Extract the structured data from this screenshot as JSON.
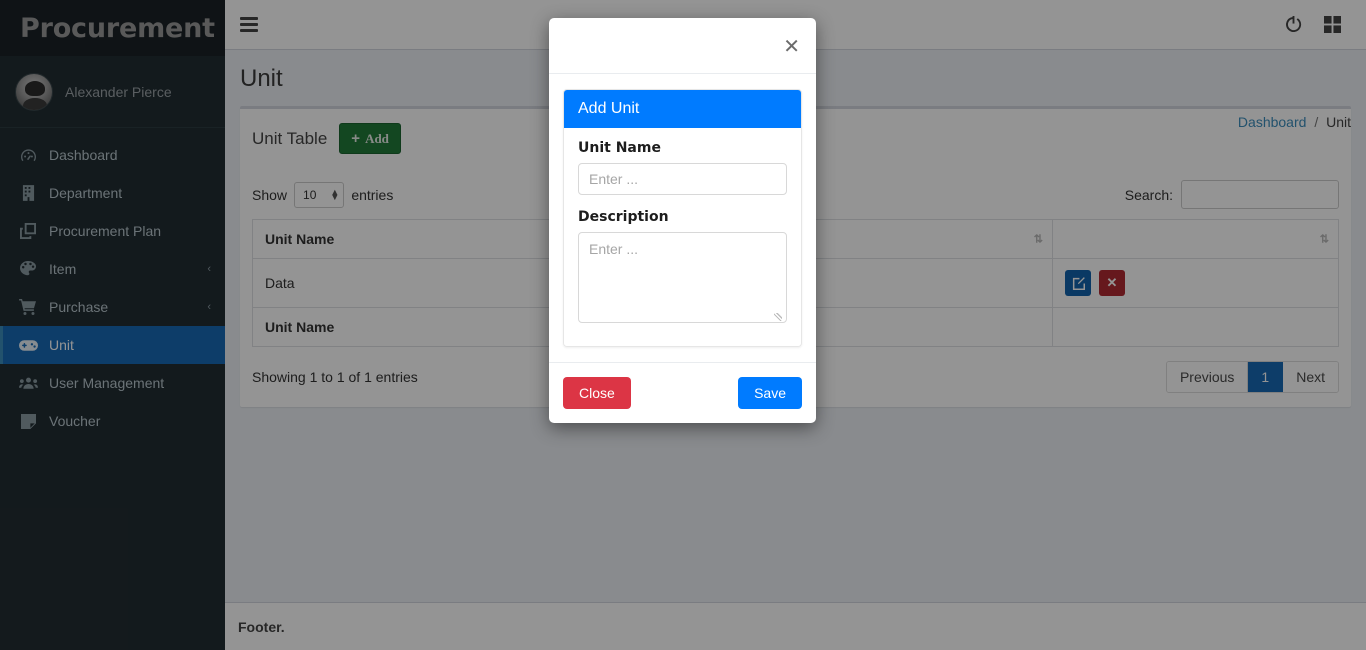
{
  "sidebar": {
    "brand": "Procurement",
    "user": {
      "name": "Alexander Pierce",
      "avatar_icon": "user-avatar"
    },
    "items": [
      {
        "label": "Dashboard",
        "icon": "dashboard-icon",
        "active": false,
        "has_arrow": false
      },
      {
        "label": "Department",
        "icon": "building-icon",
        "active": false,
        "has_arrow": false
      },
      {
        "label": "Procurement Plan",
        "icon": "copy-layers-icon",
        "active": false,
        "has_arrow": false
      },
      {
        "label": "Item",
        "icon": "palette-icon",
        "active": false,
        "has_arrow": true
      },
      {
        "label": "Purchase",
        "icon": "shopping-cart-icon",
        "active": false,
        "has_arrow": true
      },
      {
        "label": "Unit",
        "icon": "gamepad-icon",
        "active": true,
        "has_arrow": false
      },
      {
        "label": "User Management",
        "icon": "users-icon",
        "active": false,
        "has_arrow": false
      },
      {
        "label": "Voucher",
        "icon": "sticky-note-icon",
        "active": false,
        "has_arrow": false
      }
    ],
    "chevron": "‹"
  },
  "navbar": {
    "menu_toggle_icon": "hamburger-icon",
    "power_icon": "power-icon",
    "grid_icon": "grid-squares-icon"
  },
  "header": {
    "title": "Unit",
    "breadcrumb": {
      "home": "Dashboard",
      "separator": "/",
      "current": "Unit"
    }
  },
  "box": {
    "title": "Unit Table",
    "add_button": {
      "label": "Add",
      "plus": "+",
      "color": "#217a3a"
    }
  },
  "datatable": {
    "show_label": "Show",
    "entries_label": "entries",
    "page_length": "10",
    "search_label": "Search:",
    "search_value": "",
    "search_placeholder": "",
    "sort_icon": "⇅",
    "columns": [
      "Unit Name",
      "",
      ""
    ],
    "rows": [
      {
        "unit_name": "Data",
        "description": "",
        "actions": [
          "edit",
          "delete"
        ]
      }
    ],
    "footer_columns": [
      "Unit Name",
      "",
      ""
    ],
    "info": "Showing 1 to 1 of 1 entries",
    "pagination": {
      "previous": "Previous",
      "pages": [
        "1"
      ],
      "current_page": "1",
      "next": "Next"
    }
  },
  "footer": {
    "text": "Footer."
  },
  "modal": {
    "close_icon": "✕",
    "card_title": "Add Unit",
    "fields": [
      {
        "label": "Unit Name",
        "type": "text",
        "value": "",
        "placeholder": "Enter ..."
      },
      {
        "label": "Description",
        "type": "textarea",
        "value": "",
        "placeholder": "Enter ..."
      }
    ],
    "buttons": {
      "close": "Close",
      "save": "Save"
    },
    "colors": {
      "accent": "#007bff",
      "danger": "#dc3545"
    }
  }
}
